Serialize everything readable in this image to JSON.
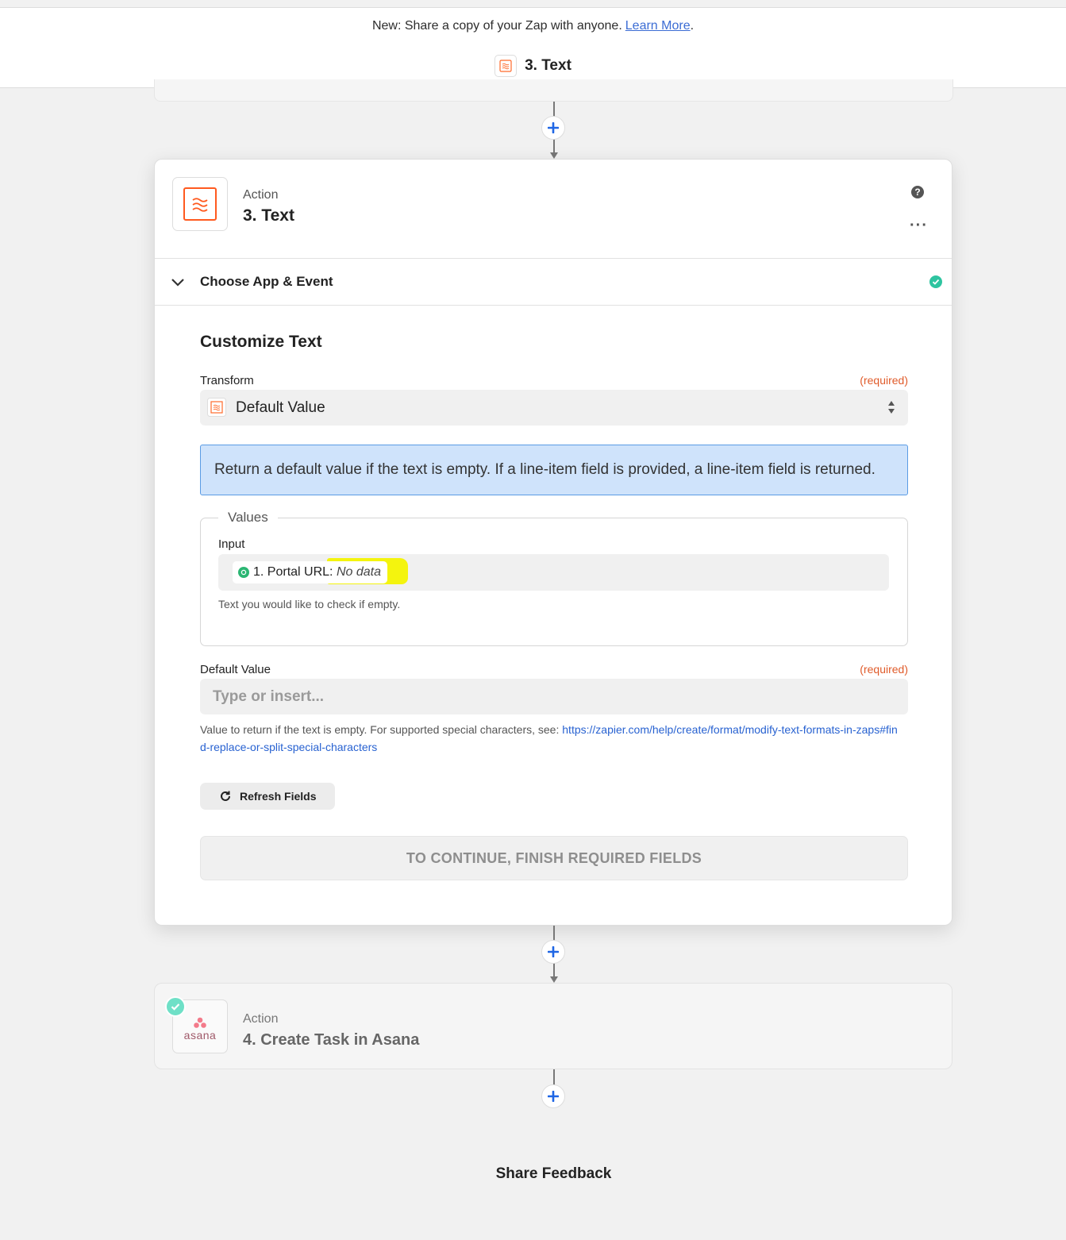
{
  "banner": {
    "text": "New: Share a copy of your Zap with anyone.",
    "link": "Learn More",
    "period": "."
  },
  "stepbar": {
    "title": "3. Text",
    "icon": "formatter-icon"
  },
  "step3": {
    "type_label": "Action",
    "title": "3. Text",
    "section_title": "Choose App & Event",
    "form_title": "Customize Text",
    "transform": {
      "label": "Transform",
      "required": "(required)",
      "value": "Default Value"
    },
    "info": "Return a default value if the text is empty. If a line-item field is provided, a line-item field is returned.",
    "values": {
      "legend": "Values",
      "input_label": "Input",
      "token_text": "1. Portal URL",
      "token_sep": ":",
      "token_value": "No data",
      "hint": "Text you would like to check if empty."
    },
    "default_value": {
      "label": "Default Value",
      "required": "(required)",
      "placeholder": "Type or insert...",
      "help_prefix": "Value to return if the text is empty. For supported special characters, see: ",
      "help_link": "https://zapier.com/help/create/format/modify-text-formats-in-zaps#find-replace-or-split-special-characters"
    },
    "refresh_label": "Refresh Fields",
    "continue_label": "TO CONTINUE, FINISH REQUIRED FIELDS"
  },
  "step4": {
    "type_label": "Action",
    "title": "4. Create Task in Asana",
    "app_word": "asana"
  },
  "footer": {
    "feedback": "Share Feedback"
  },
  "colors": {
    "accent_orange": "#ff4a00",
    "plus_blue": "#1f66e5",
    "success_green": "#2ec4a0",
    "required": "#e05b2a",
    "info_bg": "#cfe3fb",
    "highlight": "#f4f40e"
  }
}
